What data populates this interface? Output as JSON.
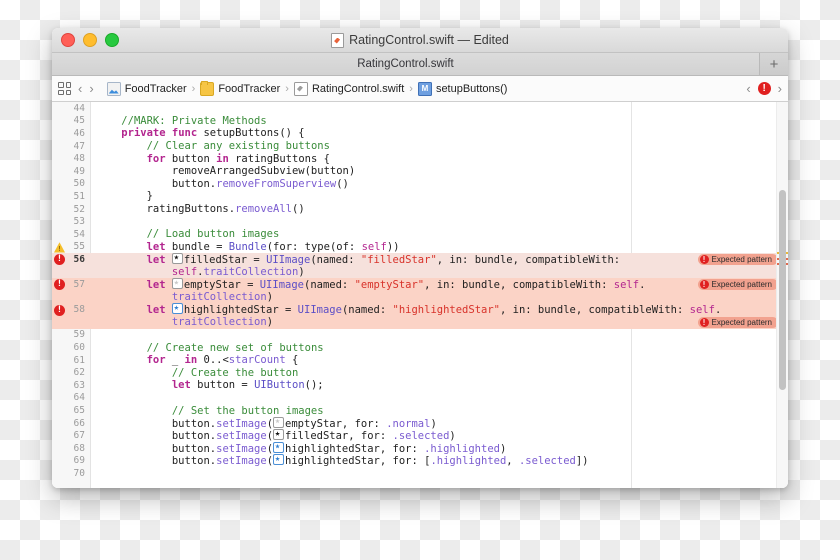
{
  "window": {
    "title": "RatingControl.swift — Edited",
    "title_icon": "swift-file-icon",
    "traffic": {
      "close": "close-button",
      "minimize": "minimize-button",
      "zoom": "zoom-button"
    }
  },
  "tabbar": {
    "tab_label": "RatingControl.swift",
    "add_label": "+"
  },
  "jumpbar": {
    "grid_icon": "related-items-icon",
    "back_label": "‹",
    "forward_label": "›",
    "crumbs": [
      {
        "label": "FoodTracker",
        "icon": "project-icon"
      },
      {
        "label": "FoodTracker",
        "icon": "folder-icon"
      },
      {
        "label": "RatingControl.swift",
        "icon": "swift-file-icon"
      },
      {
        "label": "setupButtons()",
        "icon": "method-icon"
      }
    ],
    "separator": "›",
    "prev_issue_label": "‹",
    "next_issue_label": "›",
    "issue_badge": "!"
  },
  "issue_badge_text": "Expected pattern",
  "colors": {
    "error_red": "#e02020",
    "warning_yellow": "#f5bf2b",
    "error_row": "#fbd3c6",
    "current_row": "#f6e1dc",
    "comment_green": "#3a8c3a",
    "keyword_magenta": "#b3268f",
    "string_red": "#d8322a",
    "type_purple": "#5b4ec6"
  },
  "editor": {
    "lines": [
      {
        "n": 44,
        "marker": "",
        "indent": 0,
        "tokens": []
      },
      {
        "n": 45,
        "marker": "",
        "indent": 1,
        "tokens": [
          {
            "t": "cmt",
            "v": "//MARK: Private Methods"
          }
        ]
      },
      {
        "n": 46,
        "marker": "",
        "indent": 1,
        "tokens": [
          {
            "t": "kw",
            "v": "private func "
          },
          {
            "t": "plain",
            "v": "setupButtons() {"
          }
        ]
      },
      {
        "n": 47,
        "marker": "",
        "indent": 2,
        "tokens": [
          {
            "t": "cmt",
            "v": "// Clear any existing buttons"
          }
        ]
      },
      {
        "n": 48,
        "marker": "",
        "indent": 2,
        "tokens": [
          {
            "t": "kw",
            "v": "for "
          },
          {
            "t": "plain",
            "v": "button "
          },
          {
            "t": "kw",
            "v": "in "
          },
          {
            "t": "plain",
            "v": "ratingButtons {"
          }
        ]
      },
      {
        "n": 49,
        "marker": "",
        "indent": 3,
        "tokens": [
          {
            "t": "plain",
            "v": "removeArrangedSubview(button)"
          }
        ]
      },
      {
        "n": 50,
        "marker": "",
        "indent": 3,
        "tokens": [
          {
            "t": "plain",
            "v": "button."
          },
          {
            "t": "mem",
            "v": "removeFromSuperview"
          },
          {
            "t": "plain",
            "v": "()"
          }
        ]
      },
      {
        "n": 51,
        "marker": "",
        "indent": 2,
        "tokens": [
          {
            "t": "plain",
            "v": "}"
          }
        ]
      },
      {
        "n": 52,
        "marker": "",
        "indent": 2,
        "tokens": [
          {
            "t": "plain",
            "v": "ratingButtons."
          },
          {
            "t": "mem",
            "v": "removeAll"
          },
          {
            "t": "plain",
            "v": "()"
          }
        ]
      },
      {
        "n": 53,
        "marker": "",
        "indent": 0,
        "tokens": []
      },
      {
        "n": 54,
        "marker": "",
        "indent": 2,
        "tokens": [
          {
            "t": "cmt",
            "v": "// Load button images"
          }
        ]
      },
      {
        "n": 55,
        "marker": "warning",
        "indent": 2,
        "tokens": [
          {
            "t": "kw",
            "v": "let "
          },
          {
            "t": "underln",
            "v": "bundle "
          },
          {
            "t": "plain",
            "v": "= "
          },
          {
            "t": "typ",
            "v": "Bundle"
          },
          {
            "t": "plain",
            "v": "(for: type(of: "
          },
          {
            "t": "self",
            "v": "self"
          },
          {
            "t": "plain",
            "v": "))"
          }
        ]
      },
      {
        "n": 56,
        "marker": "error",
        "row": "current",
        "indent": 2,
        "badge": true,
        "tokens": [
          {
            "t": "kw",
            "v": "let "
          },
          {
            "t": "star",
            "v": "filled"
          },
          {
            "t": "plain",
            "v": "filledStar = "
          },
          {
            "t": "typ",
            "v": "UIImage"
          },
          {
            "t": "plain",
            "v": "(named: "
          },
          {
            "t": "str",
            "v": "\"filledStar\""
          },
          {
            "t": "plain",
            "v": ", in: bundle, compatibleWith:"
          }
        ]
      },
      {
        "n": "",
        "marker": "",
        "row": "current",
        "indent": 3,
        "tokens": [
          {
            "t": "self",
            "v": "self"
          },
          {
            "t": "plain",
            "v": "."
          },
          {
            "t": "mem",
            "v": "traitCollection"
          },
          {
            "t": "plain",
            "v": ")"
          }
        ]
      },
      {
        "n": 57,
        "marker": "error",
        "row": "error",
        "indent": 2,
        "badge": true,
        "tokens": [
          {
            "t": "kw",
            "v": "let "
          },
          {
            "t": "star",
            "v": "empty"
          },
          {
            "t": "plain",
            "v": "emptyStar = "
          },
          {
            "t": "typ",
            "v": "UIImage"
          },
          {
            "t": "plain",
            "v": "(named: "
          },
          {
            "t": "str",
            "v": "\"emptyStar\""
          },
          {
            "t": "plain",
            "v": ", in: bundle, compatibleWith: "
          },
          {
            "t": "self",
            "v": "self"
          },
          {
            "t": "plain",
            "v": "."
          }
        ]
      },
      {
        "n": "",
        "marker": "",
        "row": "error",
        "indent": 3,
        "tokens": [
          {
            "t": "mem",
            "v": "traitCollection"
          },
          {
            "t": "plain",
            "v": ")"
          }
        ]
      },
      {
        "n": 58,
        "marker": "error",
        "row": "error",
        "indent": 2,
        "tokens": [
          {
            "t": "kw",
            "v": "let "
          },
          {
            "t": "star",
            "v": "blue"
          },
          {
            "t": "plain",
            "v": "highlightedStar = "
          },
          {
            "t": "typ",
            "v": "UIImage"
          },
          {
            "t": "plain",
            "v": "(named: "
          },
          {
            "t": "str",
            "v": "\"highlightedStar\""
          },
          {
            "t": "plain",
            "v": ", in: bundle, compatibleWith: "
          },
          {
            "t": "self",
            "v": "self"
          },
          {
            "t": "plain",
            "v": "."
          }
        ]
      },
      {
        "n": "",
        "marker": "",
        "row": "error",
        "indent": 3,
        "badge": true,
        "tokens": [
          {
            "t": "mem",
            "v": "traitCollection"
          },
          {
            "t": "plain",
            "v": ")"
          }
        ]
      },
      {
        "n": 59,
        "marker": "",
        "indent": 0,
        "tokens": []
      },
      {
        "n": 60,
        "marker": "",
        "indent": 2,
        "tokens": [
          {
            "t": "cmt",
            "v": "// Create new set of buttons"
          }
        ]
      },
      {
        "n": 61,
        "marker": "",
        "indent": 2,
        "tokens": [
          {
            "t": "kw",
            "v": "for "
          },
          {
            "t": "plain",
            "v": "_ "
          },
          {
            "t": "kw",
            "v": "in "
          },
          {
            "t": "plain",
            "v": "0..<"
          },
          {
            "t": "mem",
            "v": "starCount"
          },
          {
            "t": "plain",
            "v": " {"
          }
        ]
      },
      {
        "n": 62,
        "marker": "",
        "indent": 3,
        "tokens": [
          {
            "t": "cmt",
            "v": "// Create the button"
          }
        ]
      },
      {
        "n": 63,
        "marker": "",
        "indent": 3,
        "tokens": [
          {
            "t": "kw",
            "v": "let "
          },
          {
            "t": "plain",
            "v": "button = "
          },
          {
            "t": "typ",
            "v": "UIButton"
          },
          {
            "t": "plain",
            "v": "();"
          }
        ]
      },
      {
        "n": 64,
        "marker": "",
        "indent": 0,
        "tokens": []
      },
      {
        "n": 65,
        "marker": "",
        "indent": 3,
        "tokens": [
          {
            "t": "cmt",
            "v": "// Set the button images"
          }
        ]
      },
      {
        "n": 66,
        "marker": "",
        "indent": 3,
        "tokens": [
          {
            "t": "plain",
            "v": "button."
          },
          {
            "t": "mem",
            "v": "setImage"
          },
          {
            "t": "plain",
            "v": "("
          },
          {
            "t": "star",
            "v": "empty"
          },
          {
            "t": "plain",
            "v": "emptyStar, for: "
          },
          {
            "t": "mem",
            "v": ".normal"
          },
          {
            "t": "plain",
            "v": ")"
          }
        ]
      },
      {
        "n": 67,
        "marker": "",
        "indent": 3,
        "tokens": [
          {
            "t": "plain",
            "v": "button."
          },
          {
            "t": "mem",
            "v": "setImage"
          },
          {
            "t": "plain",
            "v": "("
          },
          {
            "t": "star",
            "v": "filled"
          },
          {
            "t": "plain",
            "v": "filledStar, for: "
          },
          {
            "t": "mem",
            "v": ".selected"
          },
          {
            "t": "plain",
            "v": ")"
          }
        ]
      },
      {
        "n": 68,
        "marker": "",
        "indent": 3,
        "tokens": [
          {
            "t": "plain",
            "v": "button."
          },
          {
            "t": "mem",
            "v": "setImage"
          },
          {
            "t": "plain",
            "v": "("
          },
          {
            "t": "star",
            "v": "blue"
          },
          {
            "t": "plain",
            "v": "highlightedStar, for: "
          },
          {
            "t": "mem",
            "v": ".highlighted"
          },
          {
            "t": "plain",
            "v": ")"
          }
        ]
      },
      {
        "n": 69,
        "marker": "",
        "indent": 3,
        "tokens": [
          {
            "t": "plain",
            "v": "button."
          },
          {
            "t": "mem",
            "v": "setImage"
          },
          {
            "t": "plain",
            "v": "("
          },
          {
            "t": "star",
            "v": "blue"
          },
          {
            "t": "plain",
            "v": "highlightedStar, for: ["
          },
          {
            "t": "mem",
            "v": ".highlighted"
          },
          {
            "t": "plain",
            "v": ", "
          },
          {
            "t": "mem",
            "v": ".selected"
          },
          {
            "t": "plain",
            "v": "])"
          }
        ]
      },
      {
        "n": 70,
        "marker": "",
        "indent": 0,
        "tokens": []
      }
    ]
  }
}
